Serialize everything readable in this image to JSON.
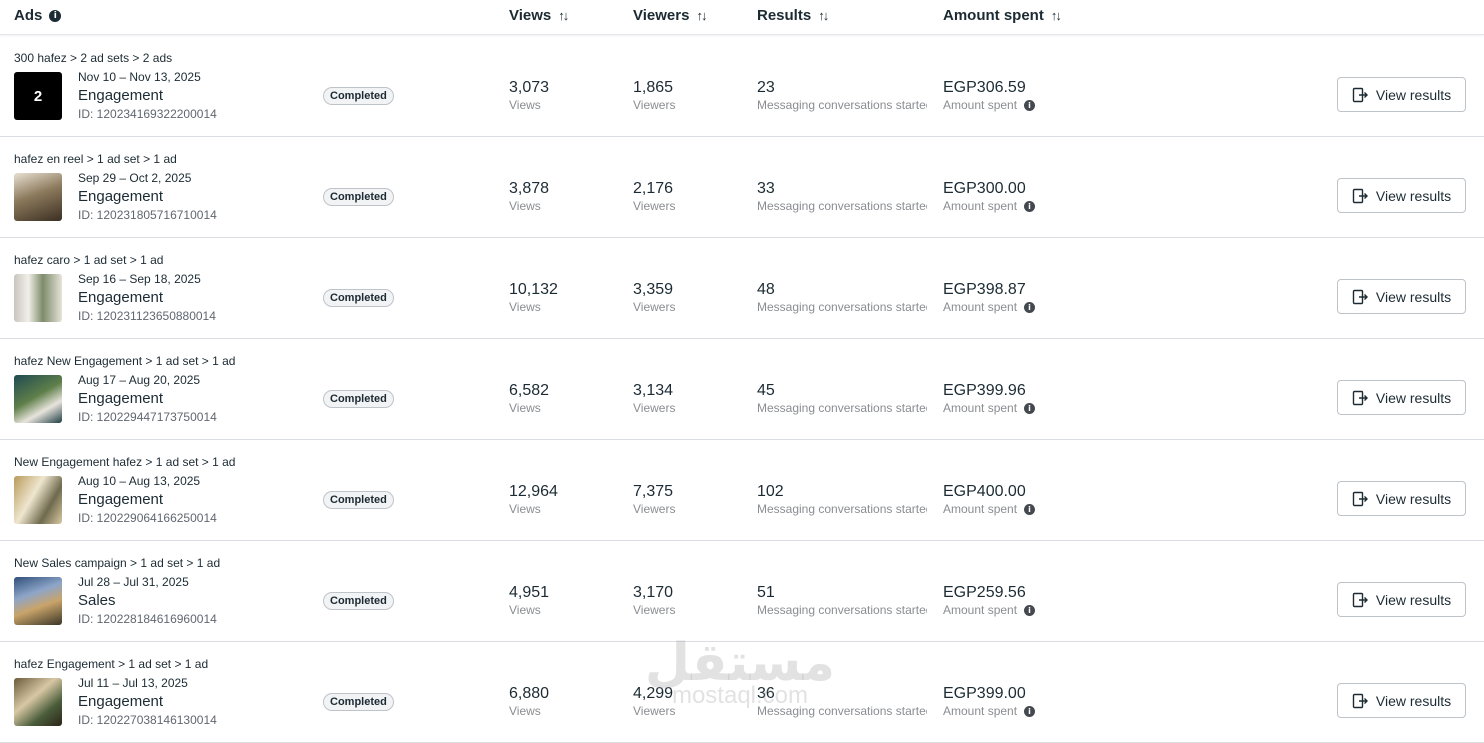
{
  "header": {
    "ads": "Ads",
    "views": "Views",
    "viewers": "Viewers",
    "results": "Results",
    "amount_spent": "Amount spent",
    "sort_glyph": "↑↓",
    "info_glyph": "i"
  },
  "button_label": "View results",
  "rows": [
    {
      "crumb": "300 hafez > 2 ad sets > 2 ads",
      "thumb_text": "2",
      "dates": "Nov 10 – Nov 13, 2025",
      "objective": "Engagement",
      "id": "ID: 120234169322200014",
      "status": "Completed",
      "views": "3,073",
      "views_label": "Views",
      "viewers": "1,865",
      "viewers_label": "Viewers",
      "results": "23",
      "results_label": "Messaging conversations started",
      "spent": "EGP306.59",
      "spent_label": "Amount spent"
    },
    {
      "crumb": "hafez en reel > 1 ad set > 1 ad",
      "dates": "Sep 29 – Oct 2, 2025",
      "objective": "Engagement",
      "id": "ID: 120231805716710014",
      "status": "Completed",
      "views": "3,878",
      "views_label": "Views",
      "viewers": "2,176",
      "viewers_label": "Viewers",
      "results": "33",
      "results_label": "Messaging conversations started",
      "spent": "EGP300.00",
      "spent_label": "Amount spent"
    },
    {
      "crumb": "hafez caro > 1 ad set > 1 ad",
      "dates": "Sep 16 – Sep 18, 2025",
      "objective": "Engagement",
      "id": "ID: 120231123650880014",
      "status": "Completed",
      "views": "10,132",
      "views_label": "Views",
      "viewers": "3,359",
      "viewers_label": "Viewers",
      "results": "48",
      "results_label": "Messaging conversations started",
      "spent": "EGP398.87",
      "spent_label": "Amount spent"
    },
    {
      "crumb": "hafez New Engagement > 1 ad set > 1 ad",
      "dates": "Aug 17 – Aug 20, 2025",
      "objective": "Engagement",
      "id": "ID: 120229447173750014",
      "status": "Completed",
      "views": "6,582",
      "views_label": "Views",
      "viewers": "3,134",
      "viewers_label": "Viewers",
      "results": "45",
      "results_label": "Messaging conversations started",
      "spent": "EGP399.96",
      "spent_label": "Amount spent"
    },
    {
      "crumb": "New Engagement hafez > 1 ad set > 1 ad",
      "dates": "Aug 10 – Aug 13, 2025",
      "objective": "Engagement",
      "id": "ID: 120229064166250014",
      "status": "Completed",
      "views": "12,964",
      "views_label": "Views",
      "viewers": "7,375",
      "viewers_label": "Viewers",
      "results": "102",
      "results_label": "Messaging conversations started",
      "spent": "EGP400.00",
      "spent_label": "Amount spent"
    },
    {
      "crumb": "New Sales campaign > 1 ad set > 1 ad",
      "dates": "Jul 28 – Jul 31, 2025",
      "objective": "Sales",
      "id": "ID: 120228184616960014",
      "status": "Completed",
      "views": "4,951",
      "views_label": "Views",
      "viewers": "3,170",
      "viewers_label": "Viewers",
      "results": "51",
      "results_label": "Messaging conversations started",
      "spent": "EGP259.56",
      "spent_label": "Amount spent"
    },
    {
      "crumb": "hafez Engagement > 1 ad set > 1 ad",
      "dates": "Jul 11 – Jul 13, 2025",
      "objective": "Engagement",
      "id": "ID: 120227038146130014",
      "status": "Completed",
      "views": "6,880",
      "views_label": "Views",
      "viewers": "4,299",
      "viewers_label": "Viewers",
      "results": "36",
      "results_label": "Messaging conversations started",
      "spent": "EGP399.00",
      "spent_label": "Amount spent"
    }
  ],
  "watermark": {
    "arabic": "مستقل",
    "latin": "mostaql.com"
  },
  "colors": {
    "text": "#1c2b33",
    "muted": "#8a8d91",
    "border": "#dadde1"
  }
}
